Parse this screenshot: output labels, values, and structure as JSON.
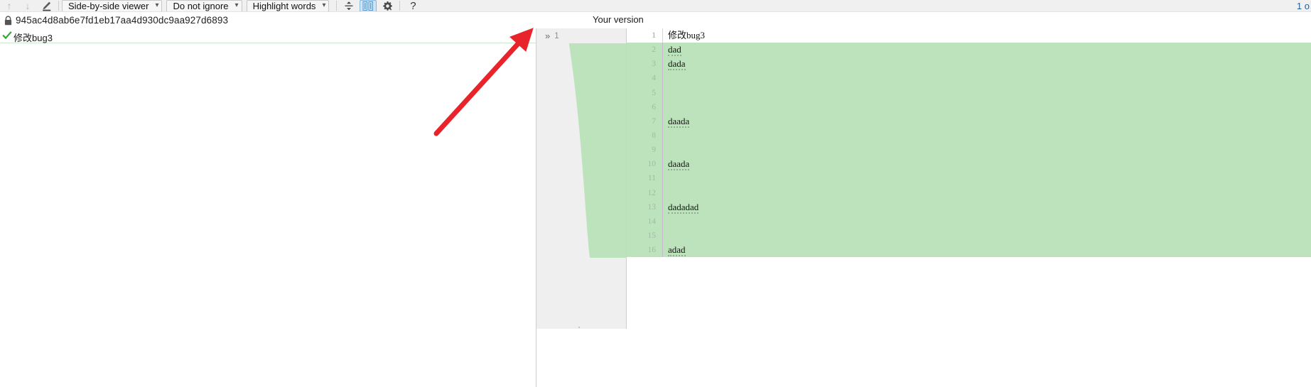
{
  "toolbar": {
    "nav_up_icon": "arrow-up-icon",
    "nav_down_icon": "arrow-down-icon",
    "edit_icon": "pencil-edit-icon",
    "viewer_mode": "Side-by-side viewer",
    "ignore_mode": "Do not ignore",
    "highlight_mode": "Highlight words",
    "caret": "⌄",
    "collapse_icon": "collapse-rows-icon",
    "sidebyside_toggle_icon": "side-by-side-columns-icon",
    "settings_icon": "gear-icon",
    "help_label": "?"
  },
  "pathbar": {
    "lock_icon": "lock-icon",
    "commit_hash": "945ac4d8ab6e7fd1eb17aa4d930dc9aa927d6893",
    "your_version_label": "Your version",
    "top_right_count": "1 o"
  },
  "left_pane": {
    "check_icon": "green-check-icon",
    "first_line_text": "修改bug3"
  },
  "bridge": {
    "chevrons": "»",
    "line_number": "1",
    "handle_icon": "drag-handle-icon"
  },
  "right_pane": {
    "lines": [
      {
        "n": "1",
        "text": "修改bug3",
        "state": "plain"
      },
      {
        "n": "2",
        "text": "dad",
        "state": "added"
      },
      {
        "n": "3",
        "text": "dada",
        "state": "added"
      },
      {
        "n": "4",
        "text": "",
        "state": "added"
      },
      {
        "n": "5",
        "text": "",
        "state": "added"
      },
      {
        "n": "6",
        "text": "",
        "state": "added"
      },
      {
        "n": "7",
        "text": "daada",
        "state": "added"
      },
      {
        "n": "8",
        "text": "",
        "state": "added"
      },
      {
        "n": "9",
        "text": "",
        "state": "added"
      },
      {
        "n": "10",
        "text": "daada",
        "state": "added"
      },
      {
        "n": "11",
        "text": "",
        "state": "added"
      },
      {
        "n": "12",
        "text": "",
        "state": "added"
      },
      {
        "n": "13",
        "text": "dadadad",
        "state": "added"
      },
      {
        "n": "14",
        "text": "",
        "state": "added"
      },
      {
        "n": "15",
        "text": "",
        "state": "added"
      },
      {
        "n": "16",
        "text": "adad",
        "state": "added"
      }
    ]
  },
  "annotation": {
    "arrow_icon": "red-pointer-arrow",
    "arrow_color": "#e8232a"
  },
  "colors": {
    "added_bg": "#bce3bc",
    "toolbar_bg": "#f0f0f0",
    "bridge_bg": "#efefef",
    "accent_blue": "#cfe4f5"
  }
}
